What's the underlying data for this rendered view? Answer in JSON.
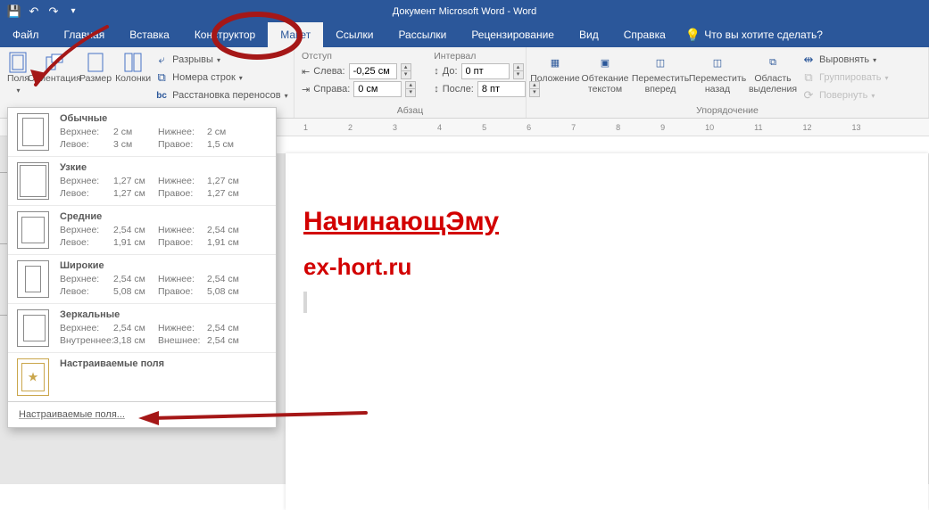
{
  "window_title": "Документ Microsoft Word  -  Word",
  "menu": {
    "file": "Файл",
    "home": "Главная",
    "insert": "Вставка",
    "design": "Конструктор",
    "layout": "Макет",
    "references": "Ссылки",
    "mailings": "Рассылки",
    "review": "Рецензирование",
    "view": "Вид",
    "help": "Справка",
    "tellme": "Что вы хотите сделать?"
  },
  "ribbon": {
    "page_setup": {
      "margins": "Поля",
      "orient": "Ориентация",
      "size": "Размер",
      "columns": "Колонки",
      "breaks": "Разрывы",
      "lines": "Номера строк",
      "hyphen": "Расстановка переносов"
    },
    "paragraph": {
      "indent_label": "Отступ",
      "interval_label": "Интервал",
      "left_label": "Слева:",
      "right_label": "Справа:",
      "before_label": "До:",
      "after_label": "После:",
      "left_val": "-0,25 см",
      "right_val": "0 см",
      "before_val": "0 пт",
      "after_val": "8 пт",
      "group": "Абзац"
    },
    "arrange": {
      "position": "Положение",
      "wrap": "Обтекание текстом",
      "forward": "Переместить вперед",
      "backward": "Переместить назад",
      "select": "Область выделения",
      "align": "Выровнять",
      "group": "Группировать",
      "rotate": "Повернуть",
      "group_label": "Упорядочение"
    }
  },
  "ruler_ticks": [
    "1",
    "2",
    "3",
    "4",
    "5",
    "6",
    "7",
    "8",
    "9",
    "10",
    "11",
    "12",
    "13"
  ],
  "document": {
    "title": "НачинающЭму",
    "subtitle": "ex-hort.ru"
  },
  "margins_menu": {
    "options": [
      {
        "name": "Обычные",
        "top_label": "Верхнее:",
        "top": "2 см",
        "bottom_label": "Нижнее:",
        "bottom": "2 см",
        "left_label": "Левое:",
        "left": "3 см",
        "right_label": "Правое:",
        "right": "1,5 см",
        "icon": "normal"
      },
      {
        "name": "Узкие",
        "top_label": "Верхнее:",
        "top": "1,27 см",
        "bottom_label": "Нижнее:",
        "bottom": "1,27 см",
        "left_label": "Левое:",
        "left": "1,27 см",
        "right_label": "Правое:",
        "right": "1,27 см",
        "icon": "narrow"
      },
      {
        "name": "Средние",
        "top_label": "Верхнее:",
        "top": "2,54 см",
        "bottom_label": "Нижнее:",
        "bottom": "2,54 см",
        "left_label": "Левое:",
        "left": "1,91 см",
        "right_label": "Правое:",
        "right": "1,91 см",
        "icon": "moderate"
      },
      {
        "name": "Широкие",
        "top_label": "Верхнее:",
        "top": "2,54 см",
        "bottom_label": "Нижнее:",
        "bottom": "2,54 см",
        "left_label": "Левое:",
        "left": "5,08 см",
        "right_label": "Правое:",
        "right": "5,08 см",
        "icon": "wide"
      },
      {
        "name": "Зеркальные",
        "top_label": "Верхнее:",
        "top": "2,54 см",
        "bottom_label": "Нижнее:",
        "bottom": "2,54 см",
        "left_label": "Внутреннее:",
        "left": "3,18 см",
        "right_label": "Внешнее:",
        "right": "2,54 см",
        "icon": "mirrored"
      }
    ],
    "custom_preset": "Настраиваемые поля",
    "custom_link": "Настраиваемые поля..."
  }
}
